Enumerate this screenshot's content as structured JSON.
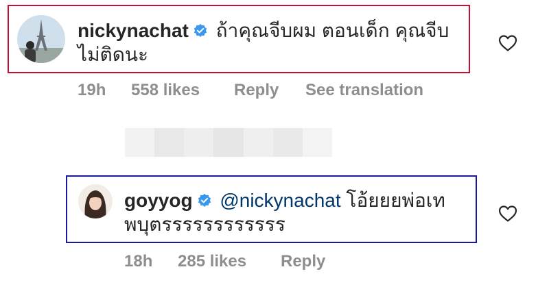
{
  "comments": [
    {
      "username": "nickynachat",
      "text": "ถ้าคุณจีบผม ตอนเด็ก คุณจีบไม่ติดนะ",
      "time": "19h",
      "likes": "558 likes",
      "reply": "Reply",
      "translate": "See translation",
      "highlight_color": "#c8102e"
    },
    {
      "username": "goyyog",
      "mention": "@nickynachat",
      "text": "โอ้ยยยพ่อเทพบุตรรรรรรรรรรรร",
      "time": "18h",
      "likes": "285 likes",
      "reply": "Reply",
      "highlight_color": "#1a1aa0"
    }
  ],
  "colors": {
    "verified_badge": "#3897f0",
    "mention": "#00376b",
    "meta_text": "#8e8e8e"
  },
  "icons": [
    "verified-badge-icon",
    "heart-icon"
  ]
}
